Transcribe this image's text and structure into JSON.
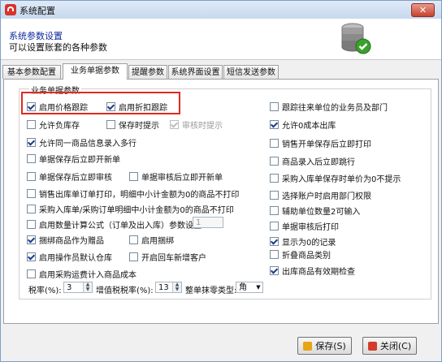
{
  "window": {
    "title": "系统配置",
    "close_label": "✕"
  },
  "header": {
    "title": "系统参数设置",
    "subtitle": "可以设置账套的各种参数"
  },
  "tabs": [
    {
      "label": "基本参数配置"
    },
    {
      "label": "业务单据参数"
    },
    {
      "label": "提醒参数"
    },
    {
      "label": "系统界面设置"
    },
    {
      "label": "短信发送参数"
    }
  ],
  "group": {
    "legend": "业务单据参数"
  },
  "options": {
    "price_tracking": {
      "label": "启用价格跟踪",
      "checked": true
    },
    "discount_tracking": {
      "label": "启用折扣跟踪",
      "checked": true
    },
    "track_partner_salesman": {
      "label": "跟踪往来单位的业务员及部门",
      "checked": false
    },
    "allow_negative_stock": {
      "label": "允许负库存",
      "checked": false
    },
    "prompt_on_save": {
      "label": "保存时提示",
      "checked": false
    },
    "prompt_on_review": {
      "label": "审核时提示",
      "checked": true
    },
    "allow_zero_cost_out": {
      "label": "允许0成本出库",
      "checked": true
    },
    "allow_same_item_multirow": {
      "label": "允许同一商品信息录入多行",
      "checked": true
    },
    "print_after_sales_save": {
      "label": "销售开单保存后立即打印",
      "checked": false
    },
    "new_after_save": {
      "label": "单据保存后立即开新单",
      "checked": false
    },
    "next_after_item_entry": {
      "label": "商品录入后立即跳行",
      "checked": false
    },
    "review_after_save": {
      "label": "单据保存后立即审核",
      "checked": false
    },
    "new_after_review": {
      "label": "单据审核后立即开新单",
      "checked": false
    },
    "zero_price_purchase_prompt": {
      "label": "采购入库单保存时单价为0不提示",
      "checked": false
    },
    "sales_order_print_no_zero": {
      "label": "销售出库单订单打印，明细中小计金额为0的商品不打印",
      "checked": false
    },
    "select_account_dept": {
      "label": "选择账户时启用部门权限",
      "checked": false
    },
    "purchase_print_no_zero": {
      "label": "采购入库单/采购订单明细中小计金额为0的商品不打印",
      "checked": false
    },
    "aux_unit_qty_input": {
      "label": "辅助单位数量2可输入",
      "checked": false
    },
    "qty_formula": {
      "label": "启用数量计算公式（订单及出入库）参数设置：",
      "checked": false
    },
    "qty_formula_value": "1",
    "print_after_review": {
      "label": "单据审核后打印",
      "checked": false
    },
    "bundle_as_gift": {
      "label": "捆绑商品作为赠品",
      "checked": true
    },
    "enable_bundle": {
      "label": "启用捆绑",
      "checked": false
    },
    "show_zero_records": {
      "label": "显示为0的记录",
      "checked": true
    },
    "collapse_categories": {
      "label": "折叠商品类别",
      "checked": false
    },
    "operator_default_warehouse": {
      "label": "启用操作员默认仓库",
      "checked": true
    },
    "new_client_on_visit": {
      "label": "开启回车新增客户",
      "checked": false
    },
    "expiry_check_out": {
      "label": "出库商品有效期检查",
      "checked": true
    },
    "purchase_freight_cost": {
      "label": "启用采购运费计入商品成本",
      "checked": false
    }
  },
  "rates": {
    "tax_label": "税率(%):",
    "tax_value": "3",
    "vat_label": "增值税税率(%):",
    "vat_value": "13",
    "rounding_label": "整单抹零类型:",
    "rounding_value": "角"
  },
  "buttons": {
    "save": "保存(S)",
    "close": "关闭(C)"
  }
}
